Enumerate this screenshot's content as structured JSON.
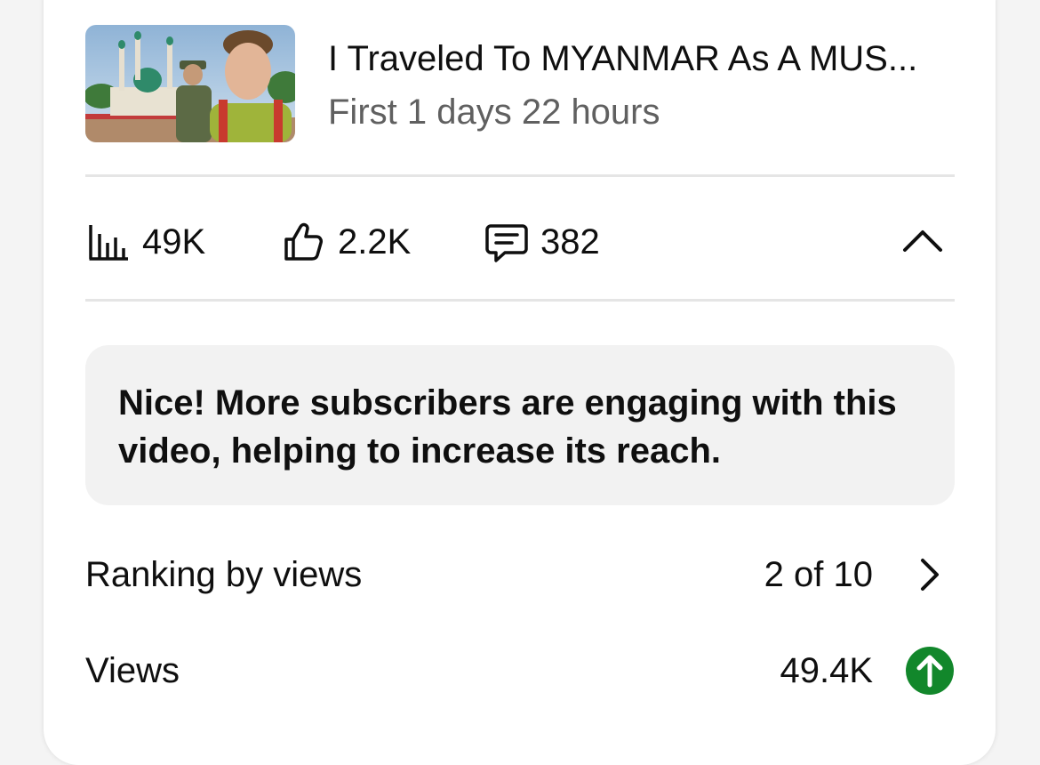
{
  "video": {
    "title": "I Traveled To MYANMAR As A MUS...",
    "subtitle": "First 1 days 22 hours",
    "thumbnail": "video-thumbnail-image"
  },
  "stats": {
    "views": {
      "icon": "bar-chart-icon",
      "value": "49K"
    },
    "likes": {
      "icon": "thumbs-up-icon",
      "value": "2.2K"
    },
    "comments": {
      "icon": "comment-icon",
      "value": "382"
    },
    "collapse_icon": "chevron-up-icon"
  },
  "banner": {
    "text": "Nice! More subscribers are engaging with this video, helping to increase its reach."
  },
  "metrics": [
    {
      "label": "Ranking by views",
      "value": "2 of 10",
      "icon": "chevron-right-icon"
    },
    {
      "label": "Views",
      "value": "49.4K",
      "icon": "arrow-up-circle-icon",
      "icon_color": "#12872b"
    }
  ],
  "colors": {
    "text_primary": "#0f0f0f",
    "text_secondary": "#606060",
    "divider": "#e5e5e5",
    "banner_bg": "#f2f2f2",
    "positive": "#12872b"
  }
}
